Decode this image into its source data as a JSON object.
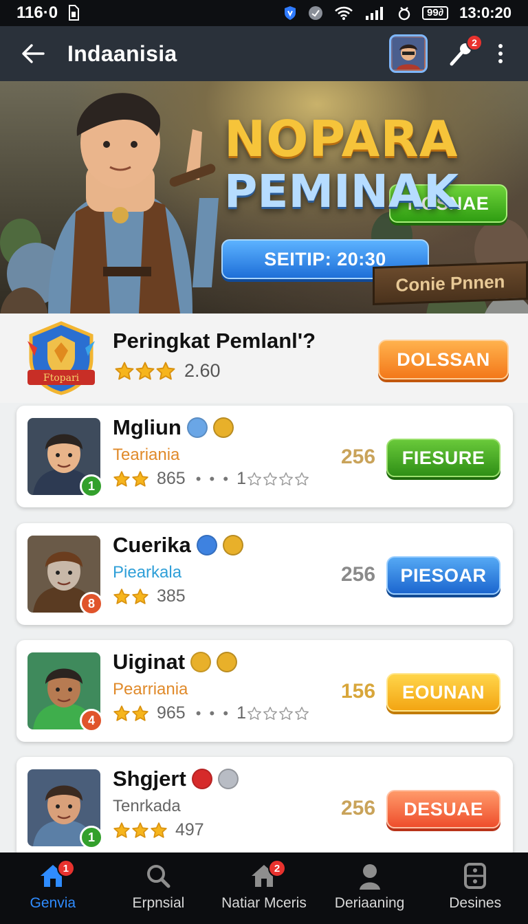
{
  "status_bar": {
    "left_text": "116·0",
    "time": "13:0:20",
    "battery": "99∂"
  },
  "app_bar": {
    "title": "Indaanisia",
    "mic_badge": "2"
  },
  "banner": {
    "title_line1": "NOPARA",
    "title_line2": "PEMINAK",
    "top_button": "NOSNAE",
    "schedule_button": "SEITIP: 20:30",
    "sign_text": "Conie Pnnen"
  },
  "rating_header": {
    "emblem_text": "Ftopari",
    "title": "Peringkat Pemlanl'?",
    "stars": 3,
    "score": "2.60",
    "button": "DOLSSAN"
  },
  "players": [
    {
      "name": "Mgliun",
      "subtitle": "Teariania",
      "subtitle_color": "#e08a2a",
      "stars": 2,
      "count": "865",
      "extra": "1",
      "extra_stars": 4,
      "score": "256",
      "score_color": "#c9a35a",
      "button": "FIESURE",
      "button_style": "green",
      "rank": "1",
      "rank_color": "#33a02c"
    },
    {
      "name": "Cuerika",
      "subtitle": "Piearkala",
      "subtitle_color": "#2f9fd8",
      "stars": 2,
      "count": "385",
      "extra": "",
      "extra_stars": 0,
      "score": "256",
      "score_color": "#8a8a8a",
      "button": "PIESOAR",
      "button_style": "blue",
      "rank": "8",
      "rank_color": "#e0542b"
    },
    {
      "name": "Uiginat",
      "subtitle": "Pearriania",
      "subtitle_color": "#e08a2a",
      "stars": 2,
      "count": "965",
      "extra": "1",
      "extra_stars": 4,
      "score": "156",
      "score_color": "#d8a63a",
      "button": "EOUNAN",
      "button_style": "yellow",
      "rank": "4",
      "rank_color": "#e0542b"
    },
    {
      "name": "Shgjert",
      "subtitle": "Tenrkada",
      "subtitle_color": "#666666",
      "stars": 3,
      "count": "497",
      "extra": "",
      "extra_stars": 0,
      "score": "256",
      "score_color": "#c9a35a",
      "button": "DESUAE",
      "button_style": "red",
      "rank": "1",
      "rank_color": "#33a02c"
    }
  ],
  "bottom_nav": [
    {
      "label": "Genvia",
      "icon": "home-icon",
      "badge": "1",
      "active": true
    },
    {
      "label": "Erpnsial",
      "icon": "search-icon",
      "badge": "",
      "active": false
    },
    {
      "label": "Natiar Mceris",
      "icon": "home-icon",
      "badge": "2",
      "active": false
    },
    {
      "label": "Deriaaning",
      "icon": "person-icon",
      "badge": "",
      "active": false
    },
    {
      "label": "Desines",
      "icon": "settings-icon",
      "badge": "",
      "active": false
    }
  ]
}
